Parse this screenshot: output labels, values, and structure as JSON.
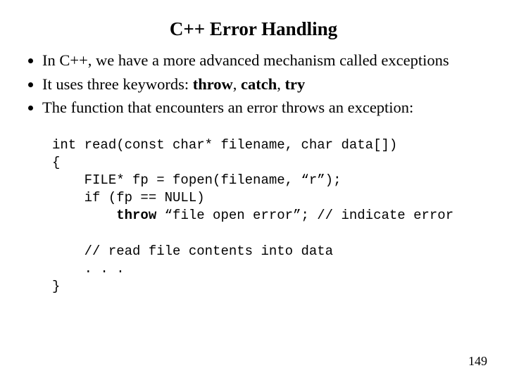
{
  "title": "C++ Error Handling",
  "bullets": {
    "b1": "In C++, we have a more advanced mechanism called exceptions",
    "b2a": "It uses three keywords: ",
    "b2_kw1": "throw",
    "b2_sep1": ", ",
    "b2_kw2": "catch",
    "b2_sep2": ", ",
    "b2_kw3": "try",
    "b3": "The function that encounters an error throws an exception:"
  },
  "code": {
    "l1": "int read(const char* filename, char data[])",
    "l2": "{",
    "l3": "    FILE* fp = fopen(filename, “r”);",
    "l4": "    if (fp == NULL)",
    "l5a": "        ",
    "l5_kw": "throw",
    "l5b": " “file open error”; // indicate error",
    "l6": "",
    "l7": "    // read file contents into data",
    "l8": "    . . .",
    "l9": "}"
  },
  "page_number": "149"
}
